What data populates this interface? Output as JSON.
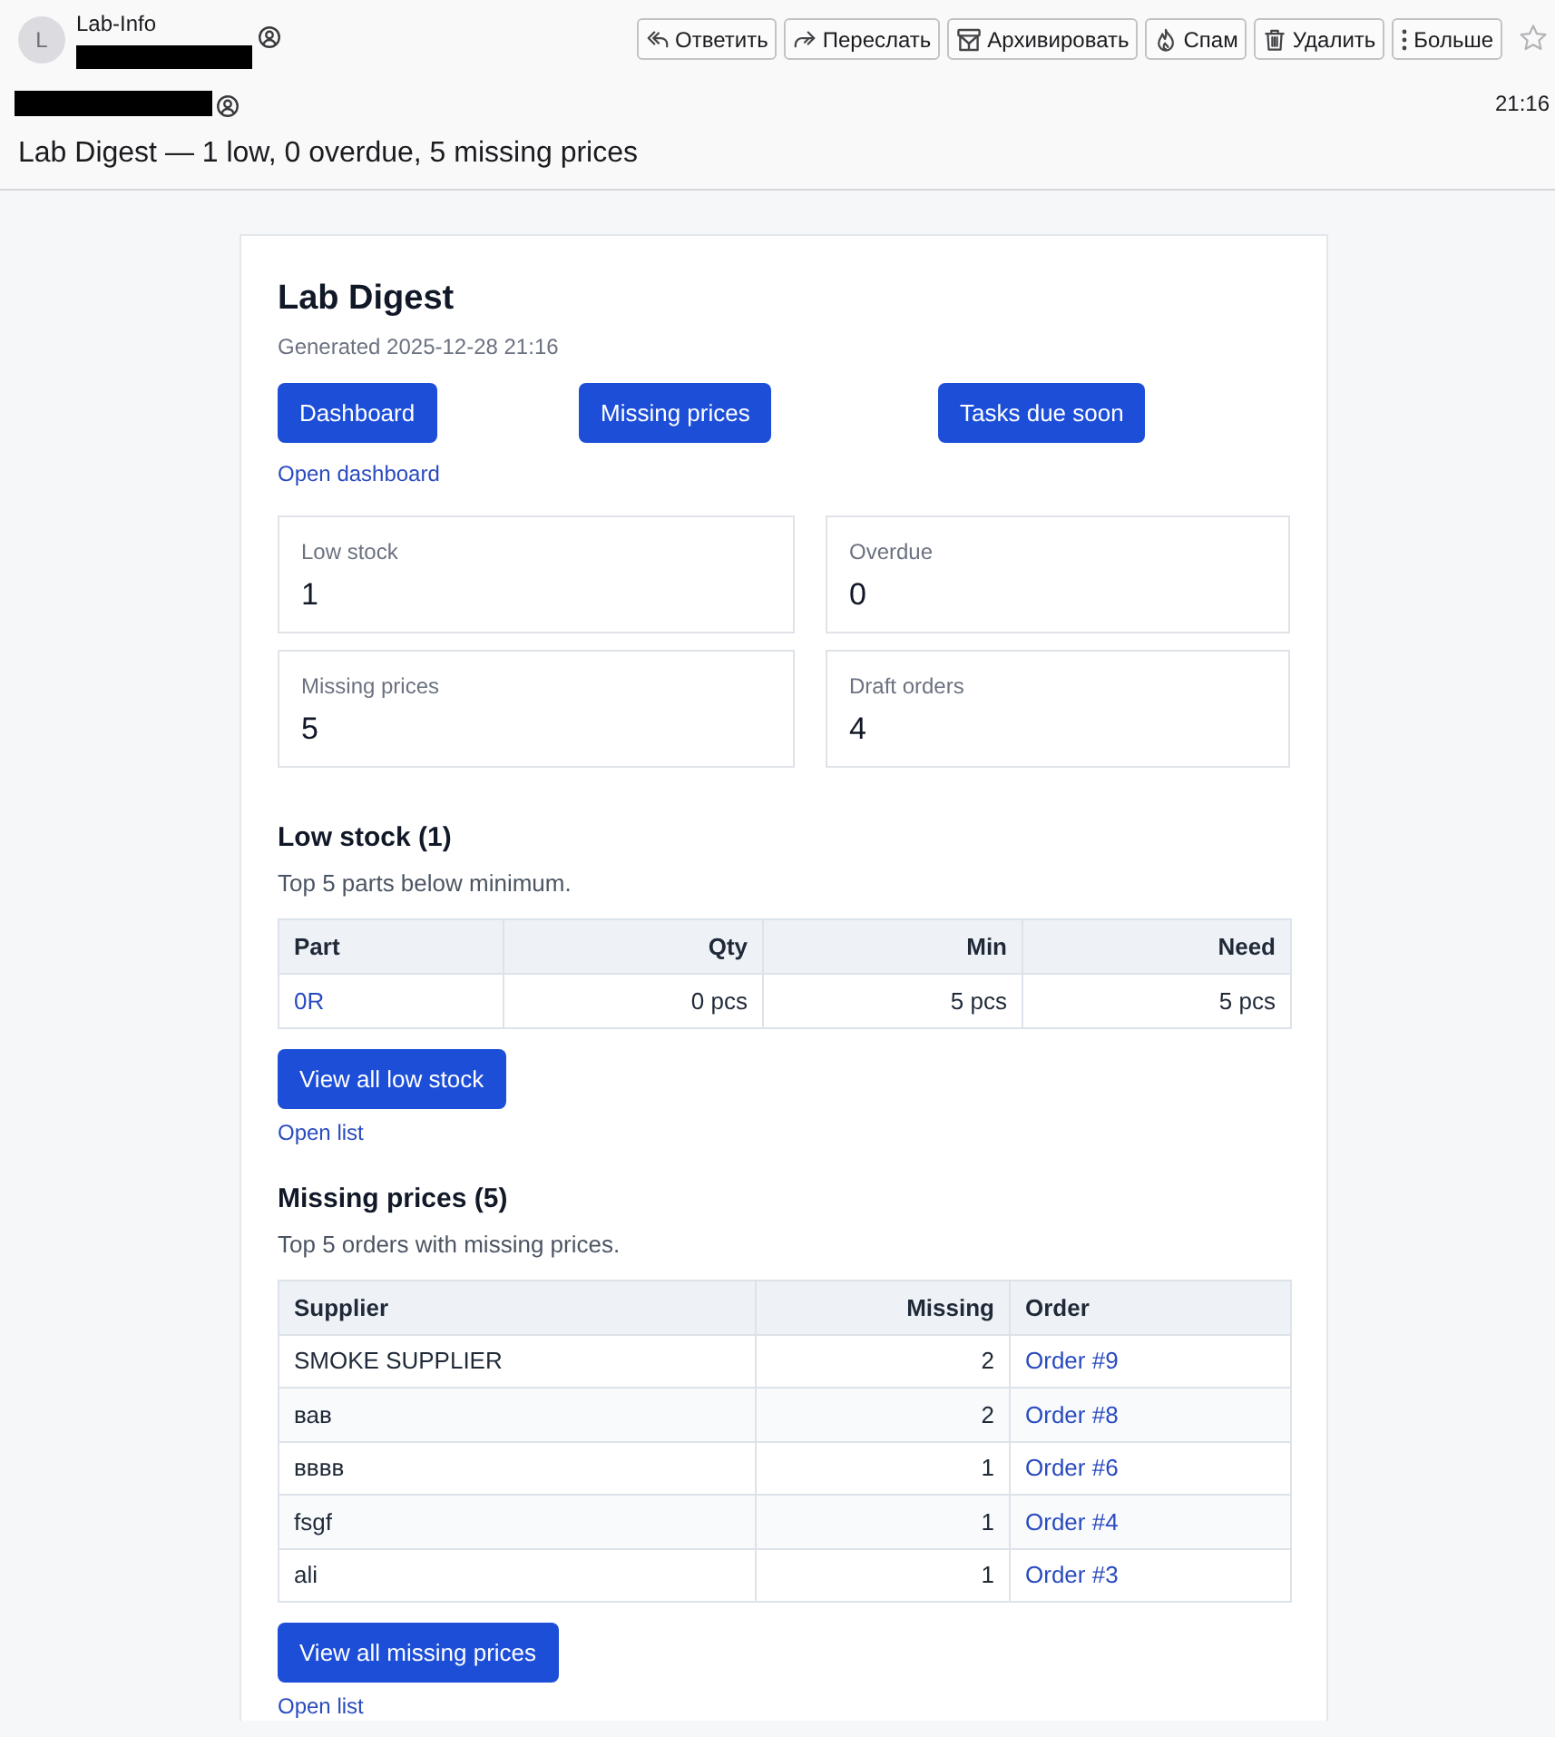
{
  "sender": {
    "avatar_letter": "L",
    "name": "Lab-Info"
  },
  "toolbar": {
    "buttons": [
      {
        "kind": "reply",
        "label": "Ответить"
      },
      {
        "kind": "forward",
        "label": "Переслать"
      },
      {
        "kind": "archive",
        "label": "Архивировать"
      },
      {
        "kind": "spam",
        "label": "Спам"
      },
      {
        "kind": "delete",
        "label": "Удалить"
      },
      {
        "kind": "more",
        "label": "Больше"
      }
    ],
    "starred": false
  },
  "time": "21:16",
  "subject": "Lab Digest — 1 low, 0 overdue, 5 missing prices",
  "digest": {
    "title": "Lab Digest",
    "generated": "Generated 2025-12-28 21:16",
    "nav_buttons": [
      "Dashboard",
      "Missing prices",
      "Tasks due soon"
    ],
    "nav_link": "Open dashboard",
    "stats": [
      {
        "label": "Low stock",
        "value": "1"
      },
      {
        "label": "Overdue",
        "value": "0"
      },
      {
        "label": "Missing prices",
        "value": "5"
      },
      {
        "label": "Draft orders",
        "value": "4"
      }
    ],
    "sections": [
      {
        "heading": "Low stock (1)",
        "description": "Top 5 parts below minimum.",
        "table": {
          "columns": [
            {
              "label": "Part",
              "kind": "text"
            },
            {
              "label": "Qty",
              "kind": "numeric"
            },
            {
              "label": "Min",
              "kind": "numeric"
            },
            {
              "label": "Need",
              "kind": "numeric"
            }
          ],
          "rows": [
            [
              {
                "kind": "link",
                "text": "0R"
              },
              {
                "kind": "text",
                "text": "0 pcs"
              },
              {
                "kind": "text",
                "text": "5 pcs"
              },
              {
                "kind": "text",
                "text": "5 pcs"
              }
            ]
          ]
        },
        "button": "View all low stock",
        "link": "Open list"
      },
      {
        "heading": "Missing prices (5)",
        "description": "Top 5 orders with missing prices.",
        "table": {
          "striped": true,
          "columns": [
            {
              "label": "Supplier",
              "kind": "text"
            },
            {
              "label": "Missing",
              "kind": "numeric"
            },
            {
              "label": "Order",
              "kind": "text"
            }
          ],
          "rows": [
            [
              {
                "kind": "text",
                "text": "SMOKE SUPPLIER"
              },
              {
                "kind": "text",
                "text": "2"
              },
              {
                "kind": "link",
                "text": "Order #9"
              }
            ],
            [
              {
                "kind": "text",
                "text": "вав"
              },
              {
                "kind": "text",
                "text": "2"
              },
              {
                "kind": "link",
                "text": "Order #8"
              }
            ],
            [
              {
                "kind": "text",
                "text": "вввв"
              },
              {
                "kind": "text",
                "text": "1"
              },
              {
                "kind": "link",
                "text": "Order #6"
              }
            ],
            [
              {
                "kind": "text",
                "text": "fsgf"
              },
              {
                "kind": "text",
                "text": "1"
              },
              {
                "kind": "link",
                "text": "Order #4"
              }
            ],
            [
              {
                "kind": "text",
                "text": "ali"
              },
              {
                "kind": "text",
                "text": "1"
              },
              {
                "kind": "link",
                "text": "Order #3"
              }
            ]
          ]
        },
        "button": "View all missing prices",
        "link": "Open list"
      }
    ]
  }
}
